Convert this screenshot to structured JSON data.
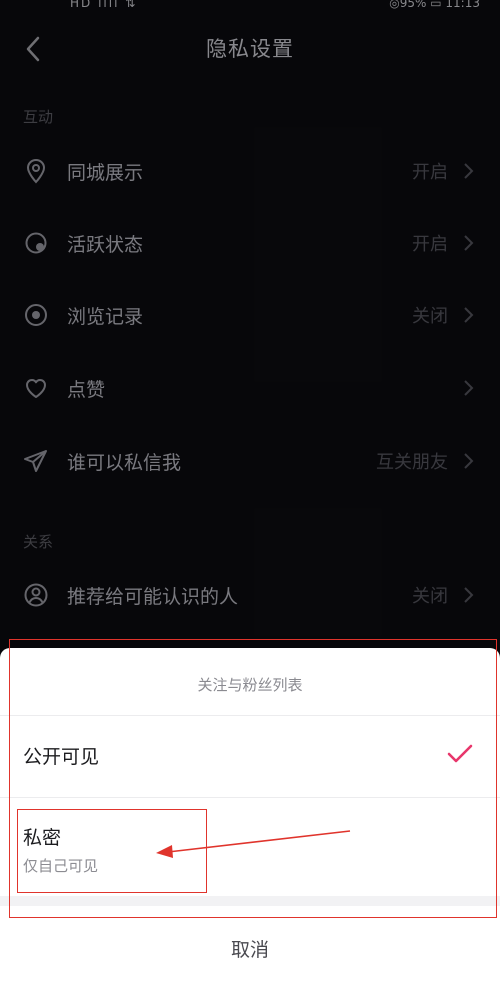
{
  "status_bar": {
    "left": "HD ıııl ⇅",
    "right": "◎95%  ▭  11:13"
  },
  "header": {
    "title": "隐私设置"
  },
  "sections": {
    "interaction": {
      "label": "互动",
      "items": [
        {
          "label": "同城展示",
          "value": "开启",
          "icon": "location-pin-icon"
        },
        {
          "label": "活跃状态",
          "value": "开启",
          "icon": "activity-status-icon"
        },
        {
          "label": "浏览记录",
          "value": "关闭",
          "icon": "eye-icon"
        },
        {
          "label": "点赞",
          "value": "",
          "icon": "heart-icon"
        },
        {
          "label": "谁可以私信我",
          "value": "互关朋友",
          "icon": "paper-plane-icon"
        }
      ]
    },
    "relations": {
      "label": "关系",
      "items": [
        {
          "label": "推荐给可能认识的人",
          "value": "关闭",
          "icon": "user-circle-icon"
        }
      ]
    }
  },
  "sheet": {
    "title": "关注与粉丝列表",
    "options": [
      {
        "label": "公开可见",
        "selected": true
      },
      {
        "label": "私密",
        "sublabel": "仅自己可见",
        "selected": false
      }
    ],
    "cancel": "取消"
  },
  "colors": {
    "accent": "#e8366b",
    "annotation": "#e0342c",
    "background": "#0b0b0f"
  }
}
